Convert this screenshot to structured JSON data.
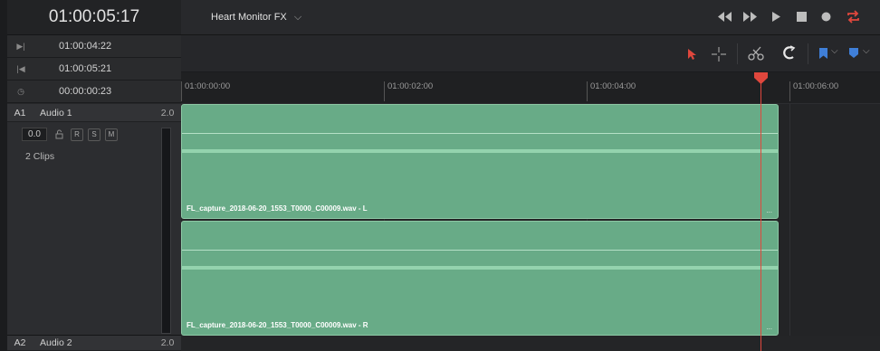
{
  "timecode": {
    "current": "01:00:05:17",
    "in": "01:00:04:22",
    "out": "01:00:05:21",
    "duration": "00:00:00:23"
  },
  "timeline": {
    "name": "Heart Monitor FX"
  },
  "ruler": {
    "ticks": [
      "01:00:00:00",
      "01:00:02:00",
      "01:00:04:00",
      "01:00:06:00"
    ]
  },
  "tracks": [
    {
      "id": "A1",
      "name": "Audio 1",
      "channels": "2.0",
      "volume": "0.0",
      "buttons": [
        "R",
        "S",
        "M"
      ],
      "clip_count": "2 Clips"
    },
    {
      "id": "A2",
      "name": "Audio 2",
      "channels": "2.0"
    }
  ],
  "clips": [
    {
      "name": "FL_capture_2018-06-20_1553_T0000_C00009.wav - L",
      "more": "..."
    },
    {
      "name": "FL_capture_2018-06-20_1553_T0000_C00009.wav - R",
      "more": "..."
    }
  ],
  "icons": {
    "in": "mark-in-icon",
    "out": "mark-out-icon",
    "duration": "clock-icon"
  },
  "colors": {
    "clip": "#68ab87",
    "playhead": "#e0473d",
    "loop": "#e0473d",
    "select_tool": "#e0473d",
    "flag": "#3f7fd8"
  }
}
